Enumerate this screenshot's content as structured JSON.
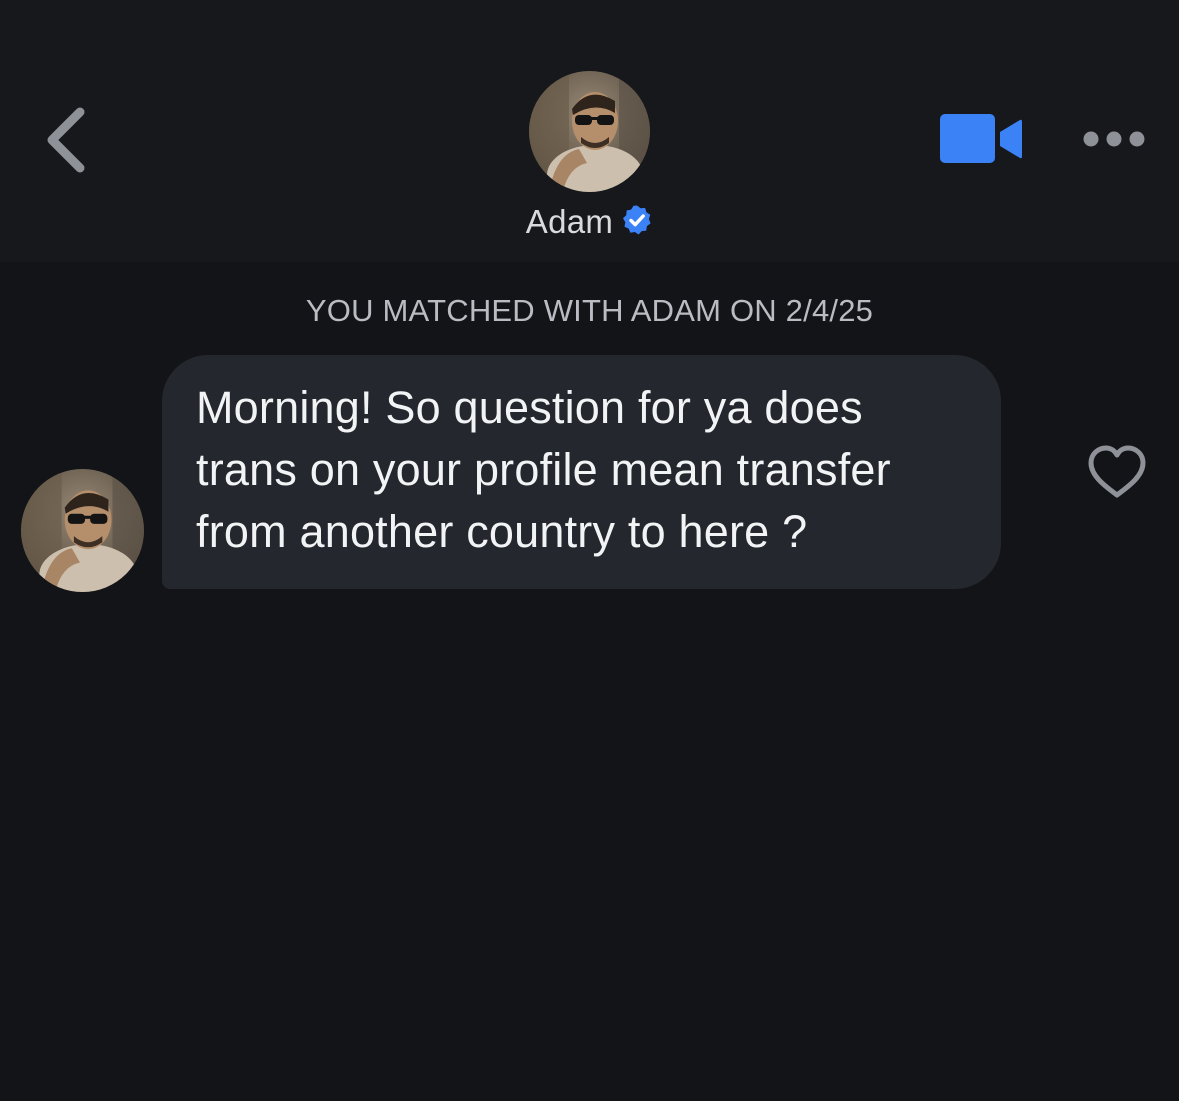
{
  "header": {
    "name": "Adam",
    "back_icon": "chevron-left-icon",
    "verified_icon": "verified-check-icon",
    "video_icon": "video-camera-icon",
    "more_icon": "more-horizontal-icon"
  },
  "conversation": {
    "match_notice": "YOU MATCHED WITH ADAM ON 2/4/25",
    "messages": [
      {
        "text": "Morning! So question for ya does\ntrans on your profile mean transfer\nfrom another country to here ?",
        "like_icon": "heart-outline-icon"
      }
    ]
  },
  "colors": {
    "background": "#121417",
    "header_background": "#16181c",
    "bubble": "#24272d",
    "accent_blue": "#3b82f6",
    "muted_icon": "#8e9198"
  }
}
